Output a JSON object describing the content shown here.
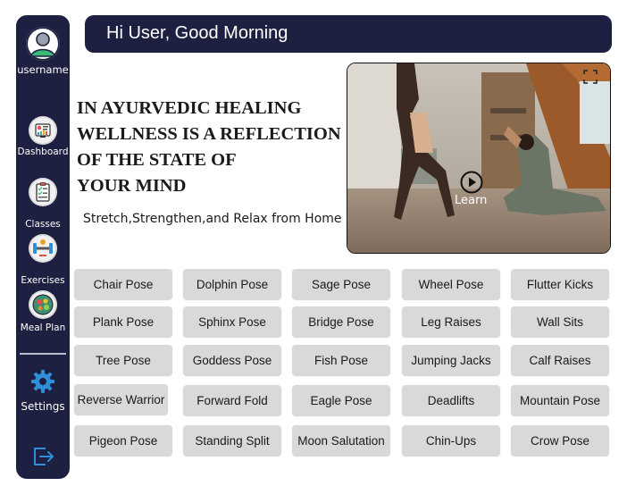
{
  "sidebar": {
    "username": "username",
    "items": [
      {
        "label": "Dashboard",
        "icon": "dashboard-icon"
      },
      {
        "label": "Classes",
        "icon": "clipboard-icon"
      },
      {
        "label": "Exercises",
        "icon": "dumbbell-icon"
      },
      {
        "label": "Meal Plan",
        "icon": "salad-bowl-icon"
      }
    ],
    "settings": {
      "label": "Settings",
      "icon": "gear-icon"
    },
    "logout_icon": "logout-icon"
  },
  "header": {
    "greeting": "Hi User, Good Morning"
  },
  "hero": {
    "title_lines": [
      "IN AYURVEDIC HEALING",
      "WELLNESS IS A REFLECTION",
      "OF THE STATE OF",
      "YOUR MIND"
    ],
    "subtitle": "Stretch,Strengthen,and Relax from Home"
  },
  "video": {
    "learn_label": "Learn",
    "play_icon": "play-icon",
    "expand_icon": "expand-icon"
  },
  "poses": [
    [
      "Chair Pose",
      "Dolphin Pose",
      "Sage Pose",
      "Wheel Pose",
      "Flutter Kicks"
    ],
    [
      "Plank Pose",
      "Sphinx Pose",
      "Bridge Pose",
      "Leg Raises",
      "Wall Sits"
    ],
    [
      "Tree Pose",
      "Goddess Pose",
      "Fish Pose",
      "Jumping Jacks",
      "Calf Raises"
    ],
    [
      "Reverse Warrior",
      "Forward Fold",
      "Eagle Pose",
      "Deadlifts",
      "Mountain Pose"
    ],
    [
      "Pigeon Pose",
      "Standing Split",
      "Moon Salutation",
      "Chin-Ups",
      "Crow Pose"
    ]
  ],
  "colors": {
    "navy": "#1d2040",
    "button": "#d9d9d9",
    "gear": "#2f8fd8"
  }
}
